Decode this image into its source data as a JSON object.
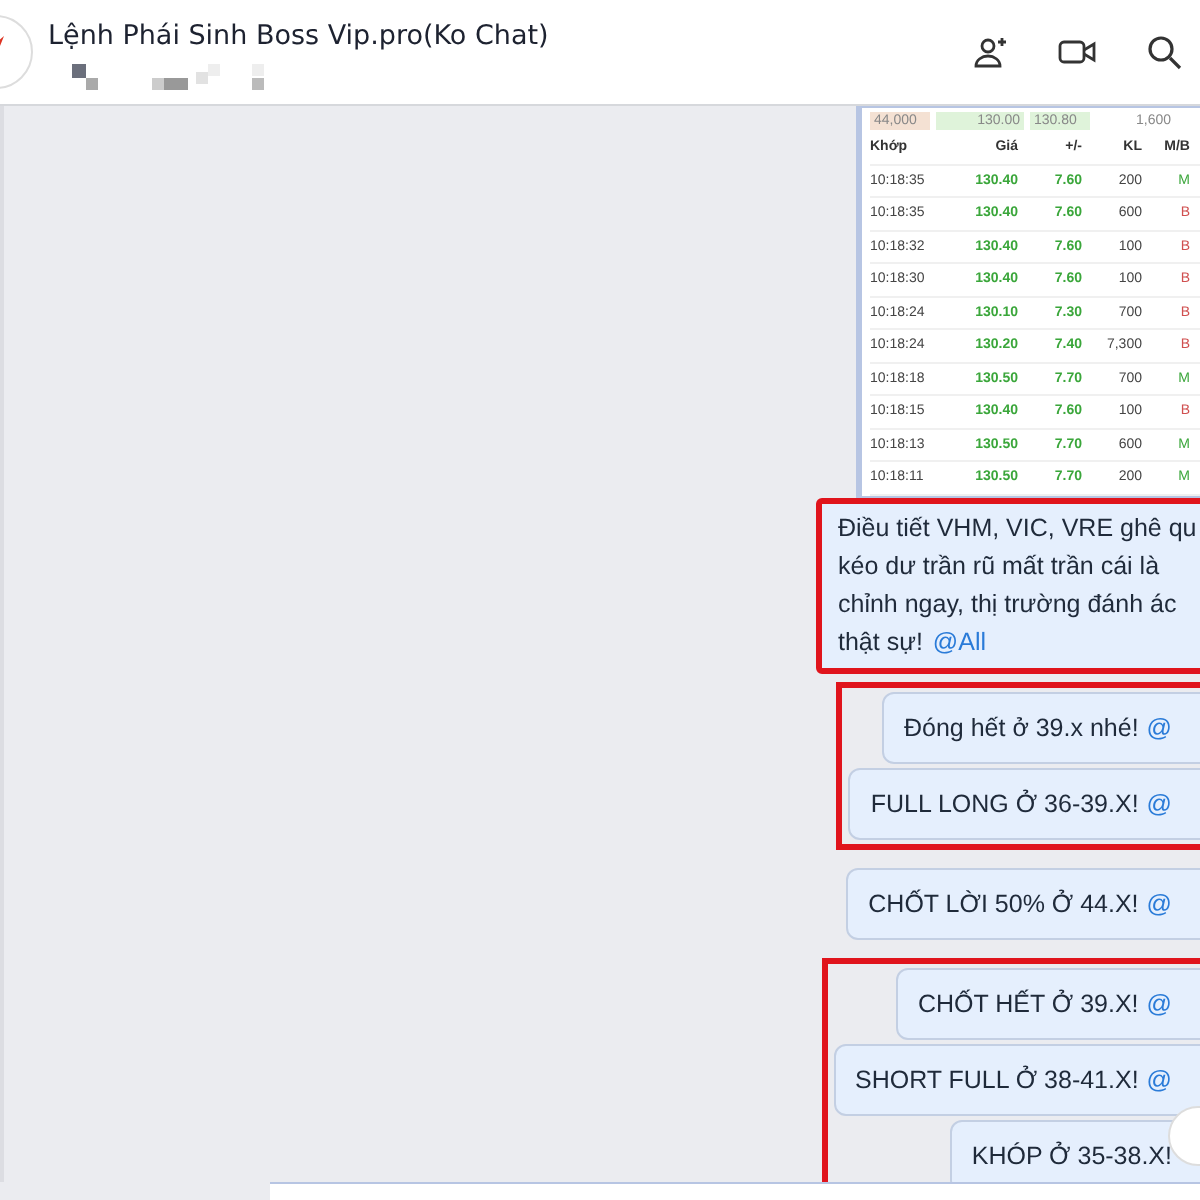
{
  "header": {
    "title": "Lệnh Phái Sinh Boss Vip.pro(Ko Chat)"
  },
  "quote_strip": [
    "44,000",
    "130.00",
    "130.80",
    "1,600"
  ],
  "trade_table": {
    "columns": [
      "Khớp",
      "Giá",
      "+/-",
      "KL",
      "M/B"
    ],
    "rows": [
      {
        "cells": [
          "10:18:35",
          "130.40",
          "7.60",
          "200",
          "M"
        ],
        "color": "#3aa63a"
      },
      {
        "cells": [
          "10:18:35",
          "130.40",
          "7.60",
          "600",
          "B"
        ],
        "color": "#d05050"
      },
      {
        "cells": [
          "10:18:32",
          "130.40",
          "7.60",
          "100",
          "B"
        ],
        "color": "#d05050"
      },
      {
        "cells": [
          "10:18:30",
          "130.40",
          "7.60",
          "100",
          "B"
        ],
        "color": "#d05050"
      },
      {
        "cells": [
          "10:18:24",
          "130.10",
          "7.30",
          "700",
          "B"
        ],
        "color": "#d05050"
      },
      {
        "cells": [
          "10:18:24",
          "130.20",
          "7.40",
          "7,300",
          "B"
        ],
        "color": "#d05050"
      },
      {
        "cells": [
          "10:18:18",
          "130.50",
          "7.70",
          "700",
          "M"
        ],
        "color": "#3aa63a"
      },
      {
        "cells": [
          "10:18:15",
          "130.40",
          "7.60",
          "100",
          "B"
        ],
        "color": "#d05050"
      },
      {
        "cells": [
          "10:18:13",
          "130.50",
          "7.70",
          "600",
          "M"
        ],
        "color": "#3aa63a"
      },
      {
        "cells": [
          "10:18:11",
          "130.50",
          "7.70",
          "200",
          "M"
        ],
        "color": "#3aa63a"
      }
    ]
  },
  "note": {
    "highlighted": true,
    "lines": [
      "Điều tiết VHM, VIC, VRE ghê qu",
      "kéo dư trần rũ mất trần cái là",
      "chỉnh ngay, thị trường đánh ác",
      "thật sự!"
    ],
    "mention": "@All"
  },
  "groups": [
    {
      "highlighted": true,
      "messages": [
        {
          "text": "Đóng hết ở 39.x nhé!",
          "mention": "@"
        },
        {
          "text": "FULL LONG Ở 36-39.X!",
          "mention": "@"
        }
      ]
    },
    {
      "highlighted": false,
      "messages": [
        {
          "text": "CHỐT LỜI 50% Ở 44.X!",
          "mention": "@"
        }
      ]
    },
    {
      "highlighted": true,
      "messages": [
        {
          "text": "CHỐT HẾT Ở 39.X!",
          "mention": "@"
        },
        {
          "text": "SHORT FULL Ở 38-41.X!",
          "mention": "@"
        },
        {
          "text": "KHÓP Ở 35-38.X!"
        }
      ]
    }
  ]
}
